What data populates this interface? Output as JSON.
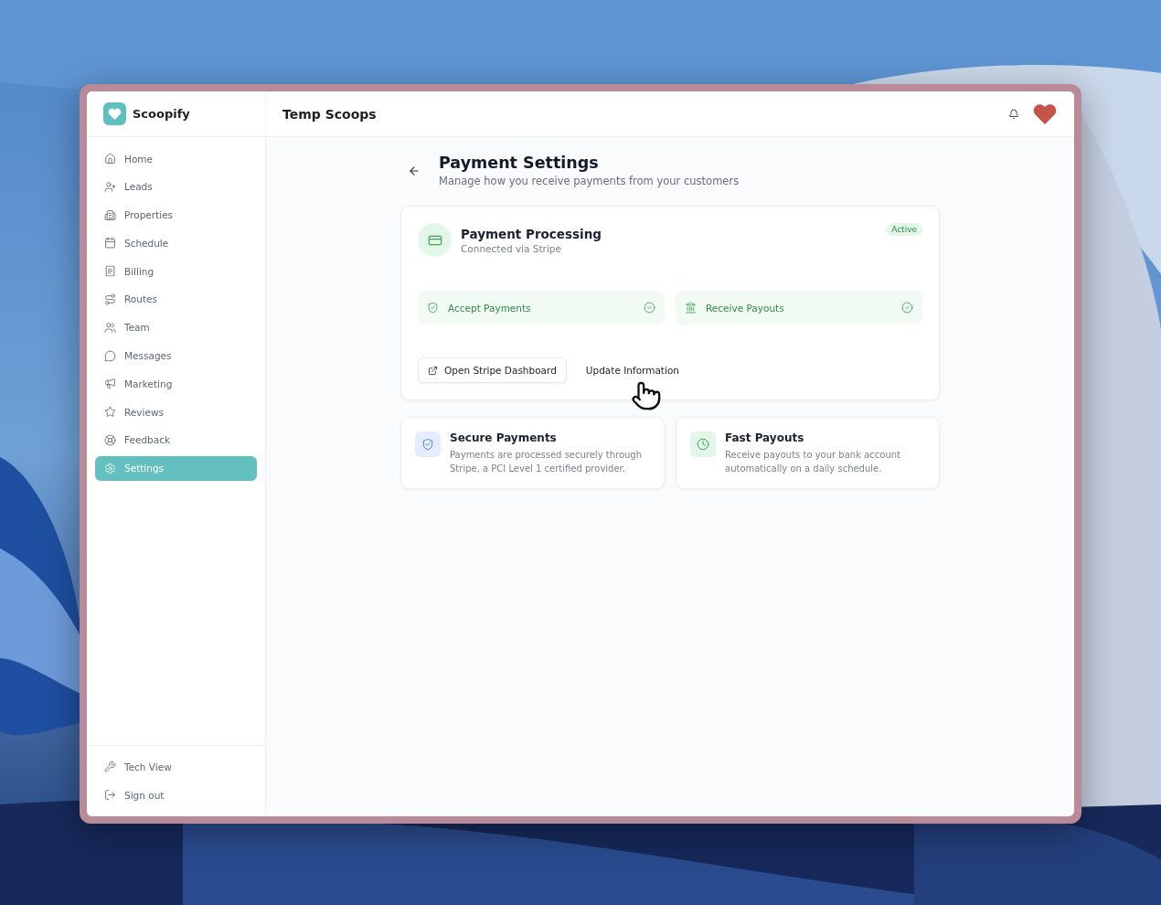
{
  "sidebar": {
    "brand": "Scoopify",
    "items": [
      {
        "label": "Home",
        "selected": false
      },
      {
        "label": "Leads",
        "selected": false
      },
      {
        "label": "Properties",
        "selected": false
      },
      {
        "label": "Schedule",
        "selected": false
      },
      {
        "label": "Billing",
        "selected": false
      },
      {
        "label": "Routes",
        "selected": false
      },
      {
        "label": "Team",
        "selected": false
      },
      {
        "label": "Messages",
        "selected": false
      },
      {
        "label": "Marketing",
        "selected": false
      },
      {
        "label": "Reviews",
        "selected": false
      },
      {
        "label": "Feedback",
        "selected": false
      },
      {
        "label": "Settings",
        "selected": true
      }
    ],
    "footer_items": [
      {
        "label": "Tech View"
      },
      {
        "label": "Sign out"
      }
    ]
  },
  "header": {
    "title": "Temp Scoops"
  },
  "page": {
    "title": "Payment Settings",
    "subtitle": "Manage how you receive payments from your customers"
  },
  "processing_card": {
    "title": "Payment Processing",
    "subtitle": "Connected via Stripe",
    "status": "Active",
    "features": [
      {
        "label": "Accept Payments",
        "checked": true
      },
      {
        "label": "Receive Payouts",
        "checked": true
      }
    ],
    "actions": [
      {
        "label": "Open Stripe Dashboard",
        "kind": "outline"
      },
      {
        "label": "Update Information",
        "kind": "ghost"
      }
    ]
  },
  "info_cards": [
    {
      "title": "Secure Payments",
      "text": "Payments are processed securely through Stripe, a PCI Level 1 certified provider."
    },
    {
      "title": "Fast Payouts",
      "text": "Receive payouts to your bank account automatically on a daily schedule."
    }
  ]
}
